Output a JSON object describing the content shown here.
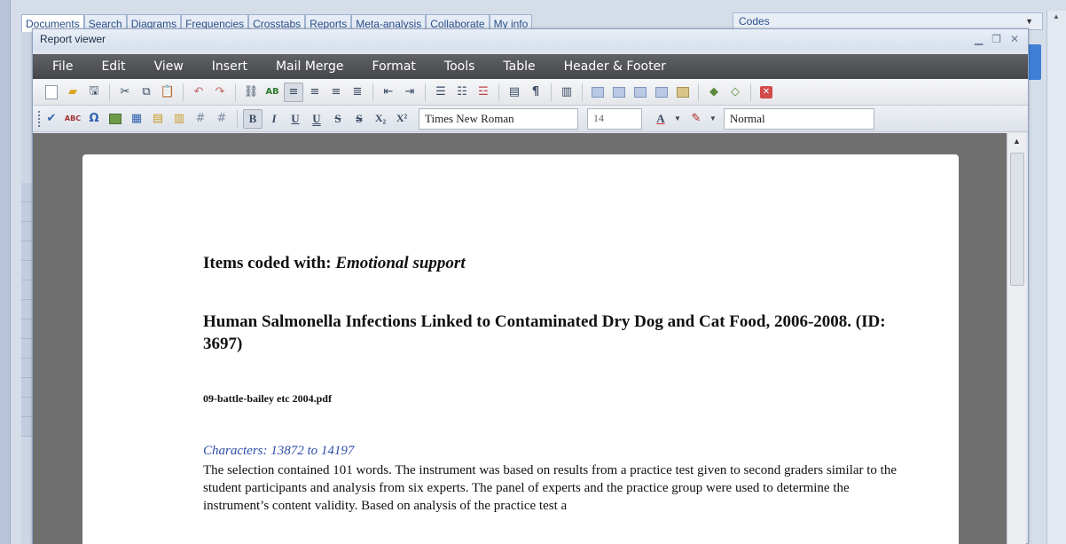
{
  "background_app": {
    "tabs": [
      "Documents",
      "Search",
      "Diagrams",
      "Frequencies",
      "Crosstabs",
      "Reports",
      "Meta-analysis",
      "Collaborate",
      "My info"
    ],
    "codes_label": "Codes",
    "left_marker": "10"
  },
  "viewer": {
    "title": "Report viewer",
    "menu": [
      "File",
      "Edit",
      "View",
      "Insert",
      "Mail Merge",
      "Format",
      "Tools",
      "Table",
      "Header & Footer"
    ],
    "font_name": "Times New Roman",
    "font_size": "14",
    "style_name": "Normal",
    "format_buttons": {
      "bold": "B",
      "italic": "I",
      "underline": "U",
      "double_underline": "U",
      "strike": "S",
      "double_strike": "S",
      "subscript": "X₂",
      "superscript": "X²"
    }
  },
  "document": {
    "heading_prefix": "Items coded with: ",
    "heading_code": "Emotional support",
    "article_title": "Human Salmonella Infections Linked to Contaminated Dry Dog and Cat Food, 2006-2008. (ID: 3697)",
    "file_name": "09-battle-bailey etc 2004.pdf",
    "characters_range": "Characters: 13872 to 14197",
    "excerpt": "The selection contained 101 words. The instrument was based on results from a practice test given to second graders similar to the student participants and analysis from six experts. The panel of experts and the practice group were used to determine the instrument’s content validity. Based on analysis of the practice test a"
  }
}
